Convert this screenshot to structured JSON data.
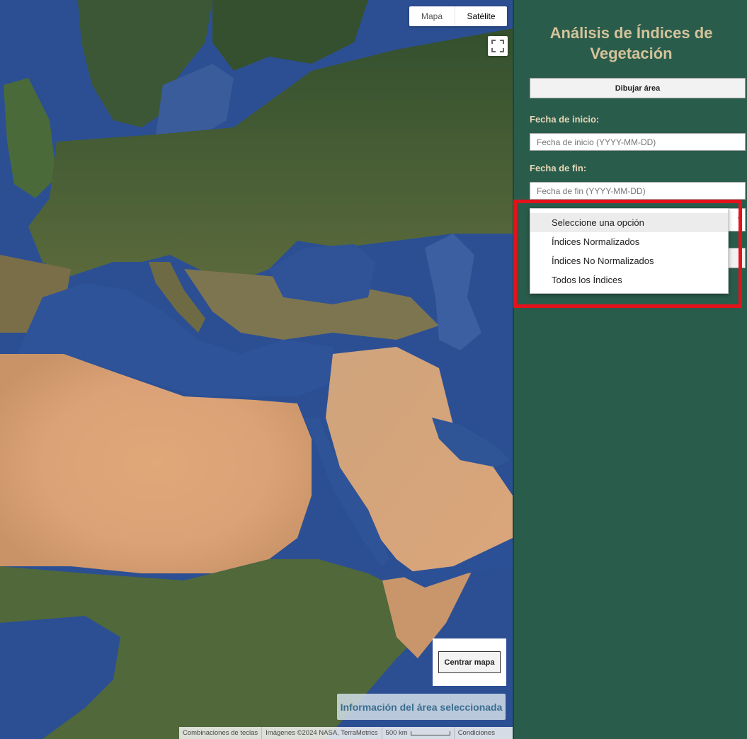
{
  "map": {
    "type_control": {
      "map_label": "Mapa",
      "satellite_label": "Satélite",
      "active": "Satélite"
    },
    "fullscreen_icon": "fullscreen-icon",
    "center_button_label": "Centrar mapa",
    "info_button_label": "Información del área seleccionada",
    "attribution": {
      "shortcuts": "Combinaciones de teclas",
      "imagery": "Imágenes ©2024 NASA, TerraMetrics",
      "scale": "500 km",
      "terms": "Condiciones"
    }
  },
  "panel": {
    "title": "Análisis de Índices de Vegetación",
    "draw_button_label": "Dibujar área",
    "start_date": {
      "label": "Fecha de inicio:",
      "placeholder": "Fecha de inicio (YYYY-MM-DD)"
    },
    "end_date": {
      "label": "Fecha de fin:",
      "placeholder": "Fecha de fin (YYYY-MM-DD)"
    },
    "index_select": {
      "options": [
        "Seleccione una opción",
        "Índices Normalizados",
        "Índices No Normalizados",
        "Todos los Índices"
      ],
      "selected": "Seleccione una opción"
    }
  },
  "colors": {
    "panel_bg": "#2a5c4c",
    "title": "#d4c39a",
    "label": "#e6d9b8",
    "highlight": "#e3121b"
  }
}
